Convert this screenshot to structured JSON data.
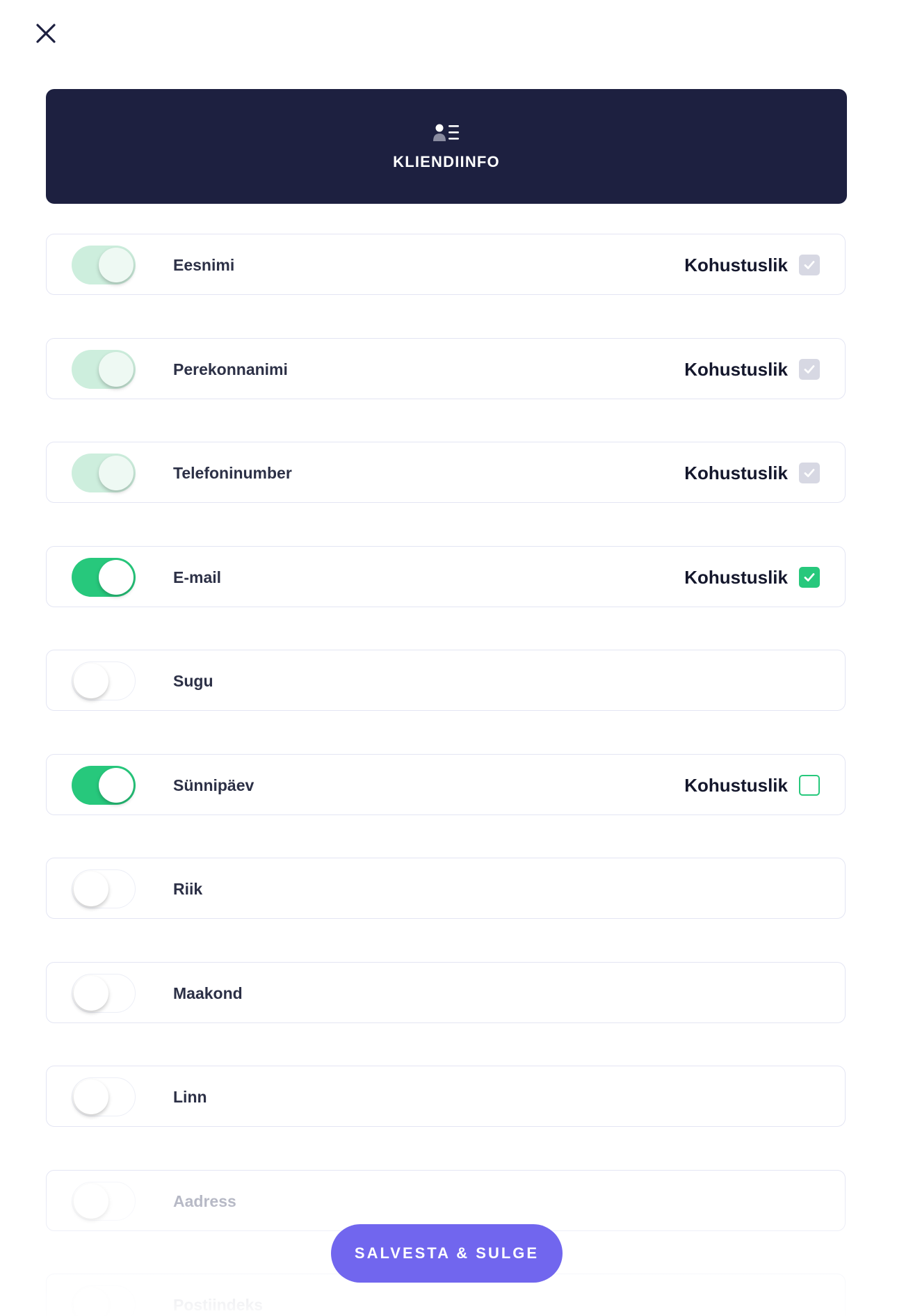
{
  "header": {
    "title": "KLIENDIINFO",
    "icon": "contact-list-icon",
    "background": "#1d2040"
  },
  "fields": [
    {
      "label": "Eesnimi",
      "enabled": true,
      "toggle_locked": true,
      "required_label": "Kohustuslik",
      "required": true,
      "required_locked": true
    },
    {
      "label": "Perekonnanimi",
      "enabled": true,
      "toggle_locked": true,
      "required_label": "Kohustuslik",
      "required": true,
      "required_locked": true
    },
    {
      "label": "Telefoninumber",
      "enabled": true,
      "toggle_locked": true,
      "required_label": "Kohustuslik",
      "required": true,
      "required_locked": true
    },
    {
      "label": "E-mail",
      "enabled": true,
      "toggle_locked": false,
      "required_label": "Kohustuslik",
      "required": true,
      "required_locked": false
    },
    {
      "label": "Sugu",
      "enabled": false
    },
    {
      "label": "Sünnipäev",
      "enabled": true,
      "toggle_locked": false,
      "required_label": "Kohustuslik",
      "required": false,
      "required_locked": false
    },
    {
      "label": "Riik",
      "enabled": false
    },
    {
      "label": "Maakond",
      "enabled": false
    },
    {
      "label": "Linn",
      "enabled": false
    },
    {
      "label": "Aadress",
      "enabled": false
    },
    {
      "label": "Postiindeks",
      "enabled": false
    }
  ],
  "save_button": {
    "label": "SALVESTA & SULGE"
  },
  "colors": {
    "accent_green": "#27c87c",
    "button_purple": "#7166ee",
    "text_dark": "#14172c"
  }
}
